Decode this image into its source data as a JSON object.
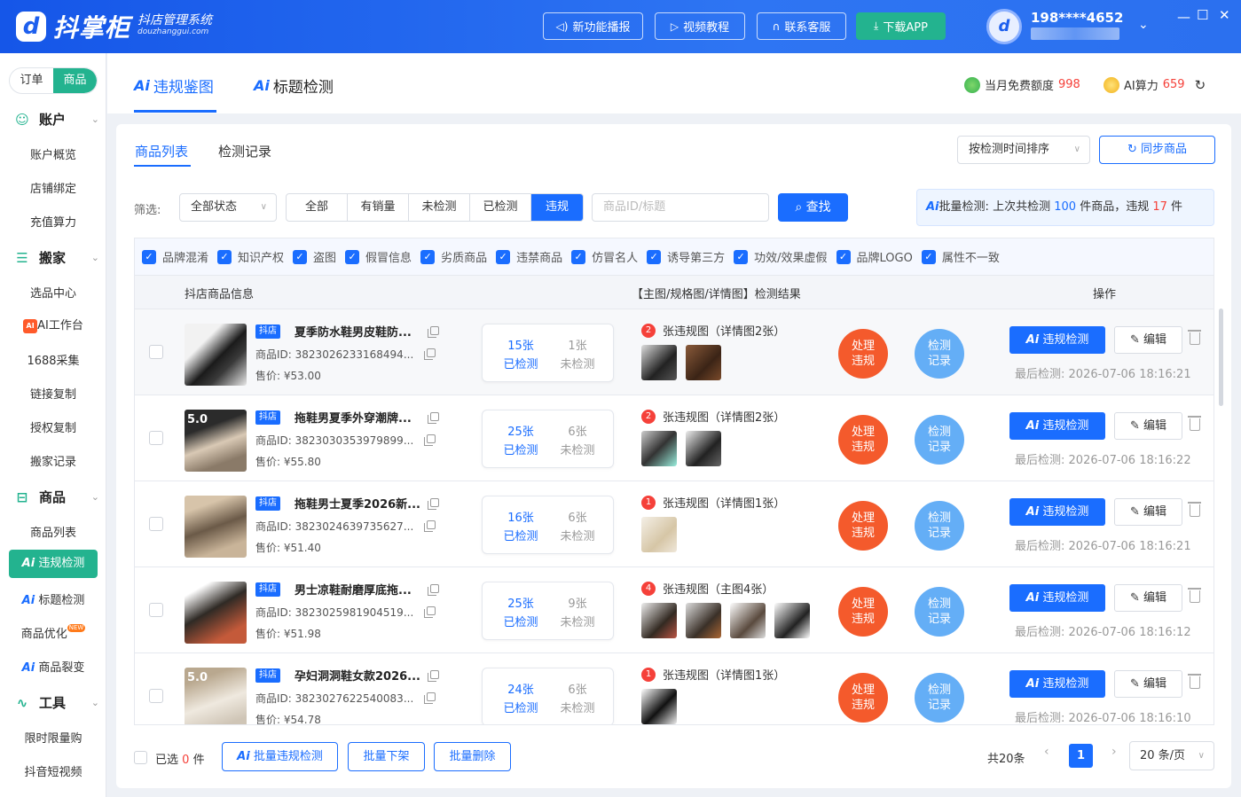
{
  "app": {
    "logo_mark": "d",
    "title": "抖掌柜",
    "subtitle": "抖店管理系统",
    "domain": "douzhanggui.com"
  },
  "topbar": {
    "buttons": [
      "新功能播报",
      "视频教程",
      "联系客服",
      "下载APP"
    ],
    "user_phone": "198****4652",
    "window_controls": [
      "minimize-icon",
      "maximize-icon",
      "close-icon"
    ]
  },
  "sidebar": {
    "mode_toggle": [
      "订单",
      "商品"
    ],
    "groups": [
      {
        "label": "账户",
        "icon": "smile-icon",
        "items": [
          "账户概览",
          "店铺绑定",
          "充值算力"
        ]
      },
      {
        "label": "搬家",
        "icon": "box-icon",
        "items": [
          "选品中心",
          "AI工作台",
          "1688采集",
          "链接复制",
          "授权复制",
          "搬家记录"
        ]
      },
      {
        "label": "商品",
        "icon": "shop-icon",
        "items": [
          "商品列表",
          "违规检测",
          "标题检测",
          "商品优化",
          "商品裂变"
        ]
      },
      {
        "label": "工具",
        "icon": "chart-icon",
        "items": [
          "限时限量购",
          "抖音短视频"
        ]
      }
    ],
    "ai_badge": "AI",
    "ai_prefix": "Ai",
    "new_badge": "NEW"
  },
  "top_tabs": [
    {
      "prefix": "Ai",
      "label": "违规鉴图"
    },
    {
      "prefix": "Ai",
      "label": "标题检测"
    }
  ],
  "quota": {
    "free_label": "当月免费额度",
    "free_value": "998",
    "ai_label": "AI算力",
    "ai_value": "659"
  },
  "sub_tabs": [
    "商品列表",
    "检测记录"
  ],
  "sort": {
    "value": "按检测时间排序"
  },
  "sync_button": "同步商品",
  "filter": {
    "label": "筛选:",
    "status_value": "全部状态",
    "segments": [
      "全部",
      "有销量",
      "未检测",
      "已检测",
      "违规"
    ],
    "active_segment": 4,
    "search_placeholder": "商品ID/标题",
    "search_button": "查找"
  },
  "batch_info": {
    "prefix": "Ai",
    "label": "批量检测:",
    "text1": "上次共检测",
    "count": "100",
    "text2": "件商品，违规",
    "violations": "17",
    "text3": "件"
  },
  "categories": [
    "品牌混淆",
    "知识产权",
    "盗图",
    "假冒信息",
    "劣质商品",
    "违禁商品",
    "仿冒名人",
    "诱导第三方",
    "功效/效果虚假",
    "品牌LOGO",
    "属性不一致"
  ],
  "table_headers": [
    "抖店商品信息",
    "【主图/规格图/详情图】检测结果",
    "操作"
  ],
  "row_labels": {
    "tag": "抖店",
    "id_prefix": "商品ID:",
    "price_prefix": "售价:",
    "checked": "已检测",
    "unchecked": "未检测",
    "handle": [
      "处理",
      "违规"
    ],
    "record": [
      "检测",
      "记录"
    ],
    "check_button_prefix": "Ai",
    "check_button": "违规检测",
    "edit": "编辑",
    "last_prefix": "最后检测:"
  },
  "products": [
    {
      "title": "夏季防水鞋男皮鞋防...",
      "id": "3823026233168494...",
      "price": "¥53.00",
      "checked": "15张",
      "unchecked": "1张",
      "violation_count": "2",
      "violation_text": "张违规图（详情图2张）",
      "images": 2,
      "last_check": "2026-07-06 18:16:21"
    },
    {
      "title": "拖鞋男夏季外穿潮牌...",
      "id": "3823030353979899...",
      "price": "¥55.80",
      "checked": "25张",
      "unchecked": "6张",
      "violation_count": "2",
      "violation_text": "张违规图（详情图2张）",
      "images": 2,
      "last_check": "2026-07-06 18:16:22"
    },
    {
      "title": "拖鞋男士夏季2026新...",
      "id": "3823024639735627...",
      "price": "¥51.40",
      "checked": "16张",
      "unchecked": "6张",
      "violation_count": "1",
      "violation_text": "张违规图（详情图1张）",
      "images": 1,
      "last_check": "2026-07-06 18:16:21"
    },
    {
      "title": "男士凉鞋耐磨厚底拖...",
      "id": "3823025981904519...",
      "price": "¥51.98",
      "checked": "25张",
      "unchecked": "9张",
      "violation_count": "4",
      "violation_text": "张违规图（主图4张）",
      "images": 4,
      "last_check": "2026-07-06 18:16:12"
    },
    {
      "title": "孕妇洞洞鞋女款2026...",
      "id": "3823027622540083...",
      "price": "¥54.78",
      "checked": "24张",
      "unchecked": "6张",
      "violation_count": "1",
      "violation_text": "张违规图（详情图1张）",
      "images": 1,
      "last_check": "2026-07-06 18:16:10"
    }
  ],
  "thumb_texts": [
    "",
    "5.0",
    "",
    "",
    "5.0"
  ],
  "footer": {
    "selected_prefix": "已选",
    "selected_count": "0",
    "selected_suffix": "件",
    "batch_check_prefix": "Ai",
    "batch_check": "批量违规检测",
    "batch_off": "批量下架",
    "batch_delete": "批量删除",
    "total": "共20条",
    "current_page": "1",
    "page_size": "20 条/页"
  },
  "colors": {
    "primary": "#1a6dff",
    "green": "#23b38f",
    "red": "#f5413a",
    "orange": "#f45a2c",
    "light_blue": "#64aef6"
  }
}
